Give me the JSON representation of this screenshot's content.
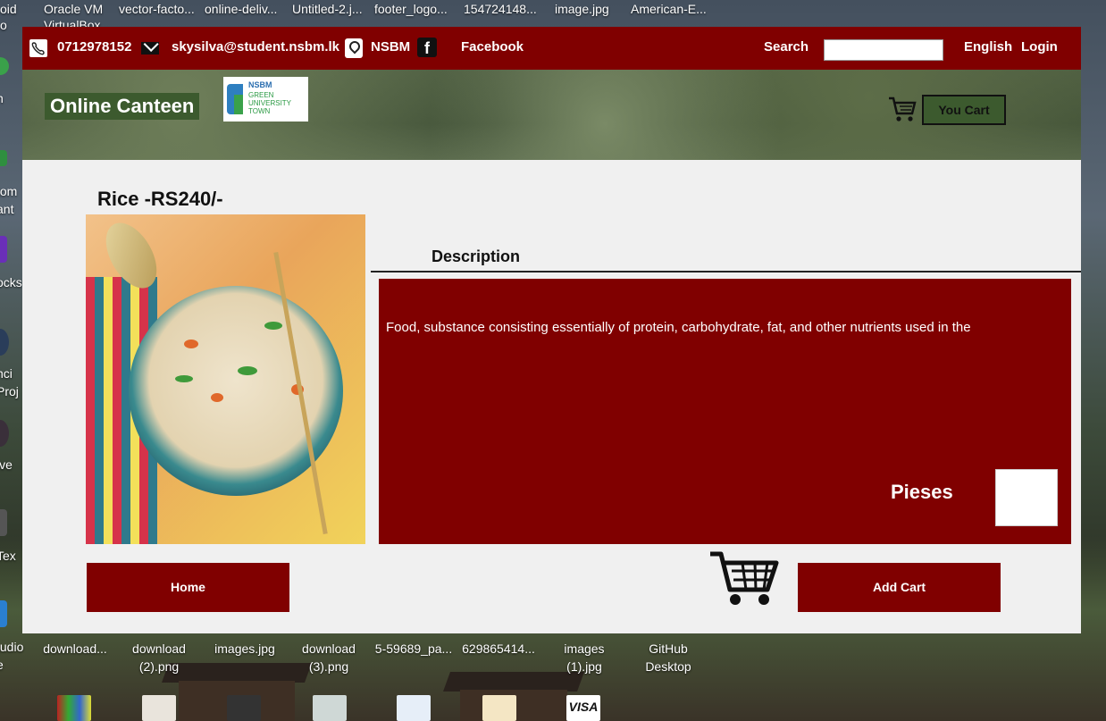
{
  "desktop": {
    "top_labels": [
      "oid",
      "Oracle VM",
      "vector-facto...",
      "online-deliv...",
      "Untitled-2.j...",
      "footer_logo...",
      "154724148...",
      "image.jpg",
      "American-E..."
    ],
    "top_label_lines2": [
      "o",
      "VirtualBox"
    ],
    "left_labels": [
      "n",
      "tom",
      "ant",
      "ocks",
      "nci",
      "Proj",
      "ive",
      "Tex",
      "tudio",
      "e"
    ],
    "bottom_labels": [
      {
        "line1": "download..."
      },
      {
        "line1": "download",
        "line2": "(2).png"
      },
      {
        "line1": "images.jpg"
      },
      {
        "line1": "download",
        "line2": "(3).png"
      },
      {
        "line1": "5-59689_pa..."
      },
      {
        "line1": "629865414..."
      },
      {
        "line1": "images",
        "line2": "(1).jpg"
      },
      {
        "line1": "GitHub",
        "line2": "Desktop"
      }
    ],
    "visa": "VISA"
  },
  "topbar": {
    "phone": "0712978152",
    "email": "skysilva@student.nsbm.lk",
    "location": "NSBM",
    "facebook": "Facebook",
    "search_label": "Search",
    "search_value": "",
    "language": "English",
    "login": "Login"
  },
  "header": {
    "brand": "Online Canteen",
    "logo_text_line1": "NSBM",
    "logo_text_line2": "GREEN",
    "logo_text_line3": "UNIVERSITY",
    "logo_text_line4": "TOWN",
    "cart_button": "You Cart"
  },
  "product": {
    "title": "Rice -RS240/-",
    "description_label": "Description",
    "description": "Food, substance consisting essentially of protein, carbohydrate, fat, and other nutrients used in the",
    "pieces_label": "Pieses",
    "pieces_value": ""
  },
  "actions": {
    "home": "Home",
    "add_cart": "Add Cart"
  },
  "colors": {
    "primary": "#800000",
    "brand_green": "#3c5a2e",
    "window_bg": "#f0f0f0"
  }
}
